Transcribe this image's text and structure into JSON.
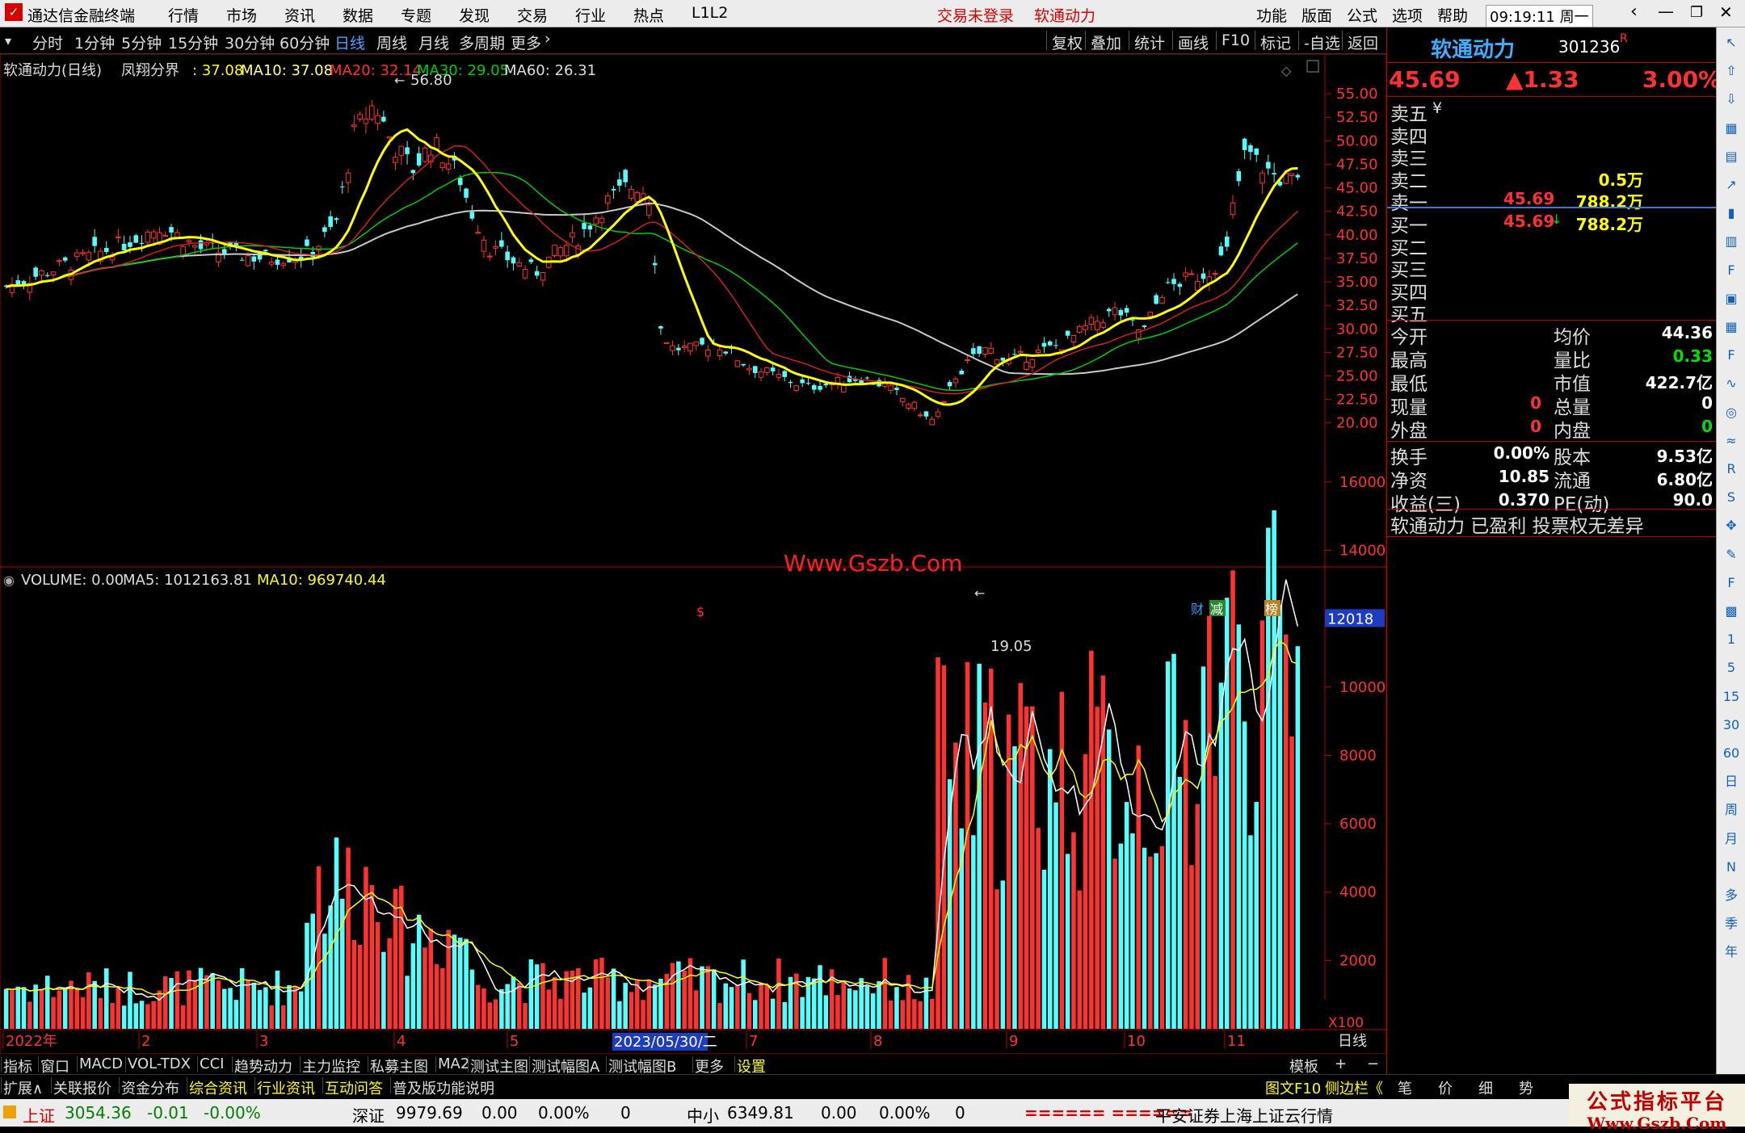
{
  "app": {
    "title": "通达信金融终端",
    "login_status": "交易未登录",
    "stock_title": "软通动力",
    "time": "09:19:11",
    "weekday": "周一"
  },
  "top_menu": [
    "行情",
    "市场",
    "资讯",
    "数据",
    "专题",
    "发现",
    "交易",
    "行业",
    "热点",
    "L1L2"
  ],
  "right_menu": [
    "功能",
    "版面",
    "公式",
    "选项",
    "帮助"
  ],
  "period_tabs": [
    "分时",
    "1分钟",
    "5分钟",
    "15分钟",
    "30分钟",
    "60分钟",
    "日线",
    "周线",
    "月线",
    "多周期",
    "更多"
  ],
  "active_period": "日线",
  "tool_tabs": [
    "复权",
    "叠加",
    "统计",
    "画线",
    "F10",
    "标记",
    "-自选",
    "返回"
  ],
  "legend": {
    "name": "软通动力(日线)",
    "indicator": "凤翔分界",
    "ma5": ": 37.08",
    "ma10": "MA10: 37.08",
    "ma20": "MA20: 32.14",
    "ma30": "MA30: 29.05",
    "ma60": "MA60: 26.31"
  },
  "vol_legend": {
    "vol": "VOLUME: 0.00",
    "ma5": "MA5: 1012163.81",
    "ma10": "MA10: 969740.44"
  },
  "colors": {
    "up": "#ff3232",
    "down": "#54ffff",
    "ma5": "#ffff00",
    "ma10": "#ffffff",
    "ma20": "#ff3232",
    "ma30": "#00cc00",
    "ma60": "#c0c0c0",
    "accent_red": "#d40000",
    "blue_highlight": "#1d3cbf"
  },
  "price_axis": [
    "55.00",
    "52.50",
    "50.00",
    "47.50",
    "45.00",
    "42.50",
    "40.00",
    "37.50",
    "35.00",
    "32.50",
    "30.00",
    "27.50",
    "25.00",
    "22.50",
    "20.00"
  ],
  "vol_axis": [
    "16000",
    "14000",
    "12000",
    "10000",
    "8000",
    "6000",
    "4000",
    "2000"
  ],
  "vol_unit": "X100",
  "vol_cursor": "12018",
  "annotations": {
    "high": "56.80",
    "low": "19.05",
    "watermark": "Www.Gszb.Com",
    "s_mark": "$",
    "cai": "财",
    "jian": "减",
    "bang": "榜"
  },
  "date_axis": [
    "2022年",
    "2",
    "3",
    "4",
    "5",
    "6",
    "7",
    "8",
    "9",
    "10",
    "11"
  ],
  "date_cursor": "2023/05/30/二",
  "period_label": "日线",
  "stock": {
    "name": "软通动力",
    "code": "301236",
    "badge": "R",
    "price": "45.69",
    "change": "▲1.33",
    "pct": "3.00%"
  },
  "orderbook": {
    "sell": [
      {
        "label": "卖五",
        "extra": "¥",
        "price": "",
        "vol": ""
      },
      {
        "label": "卖四",
        "extra": "",
        "price": "",
        "vol": ""
      },
      {
        "label": "卖三",
        "extra": "",
        "price": "",
        "vol": ""
      },
      {
        "label": "卖二",
        "extra": "",
        "price": "",
        "vol": "0.5万"
      },
      {
        "label": "卖一",
        "extra": "",
        "price": "45.69",
        "vol": "788.2万"
      }
    ],
    "buy": [
      {
        "label": "买一",
        "extra": "",
        "price": "45.69",
        "arrow": "↓",
        "vol": "788.2万"
      },
      {
        "label": "买二",
        "extra": "",
        "price": "",
        "arrow": "",
        "vol": ""
      },
      {
        "label": "买三",
        "extra": "",
        "price": "",
        "arrow": "",
        "vol": ""
      },
      {
        "label": "买四",
        "extra": "",
        "price": "",
        "arrow": "",
        "vol": ""
      },
      {
        "label": "买五",
        "extra": "",
        "price": "",
        "arrow": "",
        "vol": ""
      }
    ]
  },
  "stats": [
    {
      "l1": "今开",
      "v1": "",
      "l2": "均价",
      "v2": "44.36",
      "c2": "#ffffff"
    },
    {
      "l1": "最高",
      "v1": "",
      "l2": "量比",
      "v2": "0.33",
      "c2": "#00e000"
    },
    {
      "l1": "最低",
      "v1": "",
      "l2": "市值",
      "v2": "422.7亿",
      "c2": "#ffffff"
    },
    {
      "l1": "现量",
      "v1": "0",
      "c1": "#ff3232",
      "l2": "总量",
      "v2": "0",
      "c2": "#ffffff"
    },
    {
      "l1": "外盘",
      "v1": "0",
      "c1": "#ff3232",
      "l2": "内盘",
      "v2": "0",
      "c2": "#00e000"
    }
  ],
  "stats2": [
    {
      "l1": "换手",
      "v1": "0.00%",
      "l2": "股本",
      "v2": "9.53亿"
    },
    {
      "l1": "净资",
      "v1": "10.85",
      "l2": "流通",
      "v2": "6.80亿"
    },
    {
      "l1": "收益(三)",
      "v1": "0.370",
      "l2": "PE(动)",
      "v2": "90.0"
    }
  ],
  "stock_note": "软通动力 已盈利 投票权无差异",
  "indicator_tabs": [
    "指标",
    "窗口",
    "MACD",
    "VOL-TDX",
    "CCI",
    "趋势动力",
    "主力监控",
    "私募主图",
    "MA2",
    "测试主图",
    "测试幅图A",
    "测试幅图B",
    "更多",
    "设置"
  ],
  "indicator_right": [
    "模板",
    "+",
    "−"
  ],
  "bottom_tabs": [
    "扩展∧",
    "关联报价",
    "资金分布",
    "综合资讯",
    "行业资讯",
    "互动问答",
    "普及版功能说明"
  ],
  "bottom_right": [
    "图文F10",
    "侧边栏《",
    "笔",
    "价",
    "细",
    "势"
  ],
  "status_bar": {
    "sh_name": "上证",
    "sh_val": "3054.36",
    "sh_chg": "-0.01",
    "sh_pct": "-0.00%",
    "sz_name": "深证",
    "sz_val": "9979.69",
    "sz_chg": "0.00",
    "sz_pct": "0.00%",
    "sz_vol": "0",
    "zx_name": "中小",
    "zx_val": "6349.81",
    "zx_chg": "0.00",
    "zx_pct": "0.00%",
    "zx_vol": "0",
    "ticker": "====== ======",
    "broker": "平安证券上海上证云行情"
  },
  "watermark_box": {
    "line1": "公式指标平台",
    "line2": "Www.Gszb.Com"
  },
  "side_tools": [
    "↖",
    "⇧",
    "⇩",
    "▦",
    "▤",
    "↗",
    "▮",
    "▥",
    "F",
    "▣",
    "▦",
    "F",
    "∿",
    "◎",
    "≈",
    "R",
    "S",
    "✥",
    "✎",
    "F",
    "▩",
    "1",
    "5",
    "15",
    "30",
    "60",
    "日",
    "周",
    "月",
    "N",
    "多",
    "季",
    "年"
  ],
  "chart_data": {
    "type": "candlestick",
    "ylim": [
      18.0,
      57.5
    ],
    "vol_ylim": [
      0,
      16800
    ],
    "high_label": "56.80",
    "low_label": "19.05"
  }
}
